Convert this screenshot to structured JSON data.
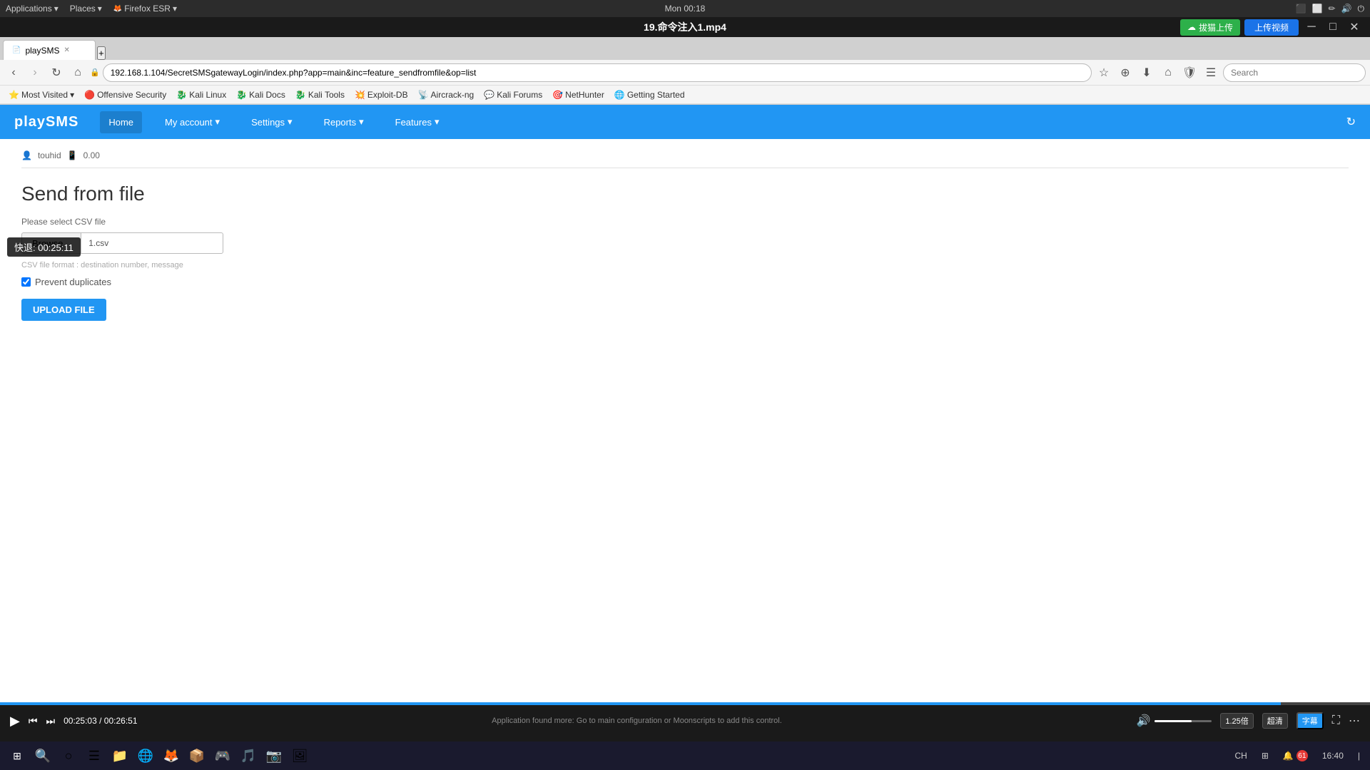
{
  "sysbar": {
    "applications": "Applications",
    "places": "Places",
    "browser": "Firefox ESR",
    "time": "Mon 00:18",
    "power_icon": "⏻"
  },
  "video_title": {
    "title": "19.命令注入1.mp4",
    "upload_label": "拔猫上传",
    "upload_btn": "上传视频"
  },
  "browser": {
    "tab_label": "playSMS",
    "url": "192.168.1.104/SecretSMSgatewayLogin/index.php?app=main&inc=feature_sendfromfile&op=list",
    "search_placeholder": "Search",
    "bookmarks": [
      {
        "label": "Most Visited"
      },
      {
        "label": "Offensive Security"
      },
      {
        "label": "Kali Linux"
      },
      {
        "label": "Kali Docs"
      },
      {
        "label": "Kali Tools"
      },
      {
        "label": "Exploit-DB"
      },
      {
        "label": "Aircrack-ng"
      },
      {
        "label": "Kali Forums"
      },
      {
        "label": "NetHunter"
      },
      {
        "label": "Getting Started"
      }
    ]
  },
  "app": {
    "brand": "playSMS",
    "nav": {
      "home": "Home",
      "my_account": "My account",
      "settings": "Settings",
      "reports": "Reports",
      "features": "Features"
    },
    "user": "touhid",
    "balance": "0.00",
    "page_title": "Send from file",
    "csv_label": "Please select CSV file",
    "browse_btn": "Browse...",
    "file_name": "1.csv",
    "csv_hint": "CSV file format : destination number, message",
    "prevent_duplicates": "Prevent duplicates",
    "upload_btn": "UPLOAD FILE"
  },
  "player": {
    "current_time": "00:25:03",
    "total_time": "00:26:51",
    "center_text": "Application found more: Go to main configuration or Moonscripts to add this control.",
    "speed": "1.25倍",
    "quality": "超清",
    "subtitle": "字幕",
    "progress_percent": 93.5,
    "volume_percent": 65,
    "rewind_tooltip": "快退: 00:25:11"
  },
  "taskbar": {
    "items": [
      "⊞",
      "🔍",
      "○",
      "☰",
      "📁",
      "🌐",
      "🔵",
      "📦",
      "🎮",
      "🎵",
      "📷"
    ],
    "right": {
      "lang": "CH",
      "grid": "⊞",
      "time": "16:40",
      "notification": "🔔"
    }
  }
}
